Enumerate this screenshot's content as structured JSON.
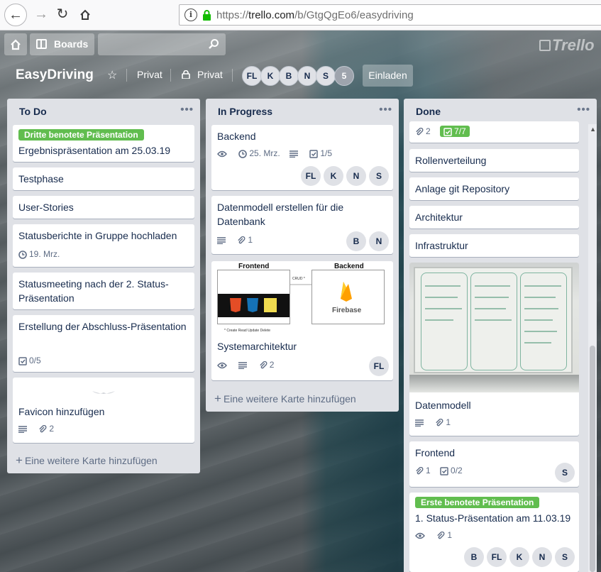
{
  "browser": {
    "url_prefix": "https://",
    "url_host": "trello.com",
    "url_path": "/b/GtgQgEo6/easydriving"
  },
  "header": {
    "boards_label": "Boards",
    "logo_text": "Trello"
  },
  "board": {
    "title": "EasyDriving",
    "visibility_1": "Privat",
    "visibility_2": "Privat",
    "members": [
      "FL",
      "K",
      "B",
      "N",
      "S",
      "5"
    ],
    "invite_label": "Einladen"
  },
  "lists": {
    "todo": {
      "title": "To Do",
      "menu": "•••",
      "add_label": "Eine weitere Karte hinzufügen",
      "cards": {
        "c1": {
          "label": "Dritte benotete Präsentation",
          "title": "Ergebnispräsentation am 25.03.19"
        },
        "c2": {
          "title": "Testphase"
        },
        "c3": {
          "title": "User-Stories"
        },
        "c4": {
          "title": "Statusberichte in Gruppe hochladen",
          "due": "19. Mrz."
        },
        "c5": {
          "title": "Statusmeeting nach der 2. Status-Präsentation"
        },
        "c6": {
          "title": "Erstellung der Abschluss-Präsentation",
          "checklist": "0/5"
        },
        "c7": {
          "title": "Favicon hinzufügen",
          "attachments": "2"
        }
      }
    },
    "progress": {
      "title": "In Progress",
      "menu": "•••",
      "add_label": "Eine weitere Karte hinzufügen",
      "cards": {
        "c1": {
          "title": "Backend",
          "due": "25. Mrz.",
          "checklist": "1/5",
          "members": [
            "FL",
            "K",
            "N",
            "S"
          ]
        },
        "c2": {
          "title": "Datenmodell erstellen für die Datenbank",
          "attachments": "1",
          "members": [
            "B",
            "N"
          ]
        },
        "c3": {
          "title": "Systemarchitektur",
          "attachments": "2",
          "members": [
            "FL"
          ],
          "cover": {
            "frontend": "Frontend",
            "backend": "Backend",
            "crud": "CRUD *",
            "firebase": "Firebase",
            "footnote": "* Create Read Update Delete"
          }
        }
      }
    },
    "done": {
      "title": "Done",
      "menu": "•••",
      "cards": {
        "c0": {
          "attachments": "2",
          "checklist": "7/7"
        },
        "c1": {
          "title": "Rollenverteilung"
        },
        "c2": {
          "title": "Anlage git Repository"
        },
        "c3": {
          "title": "Architektur"
        },
        "c4": {
          "title": "Infrastruktur"
        },
        "c5": {
          "title": "Datenmodell",
          "attachments": "1"
        },
        "c6": {
          "title": "Frontend",
          "attachments": "1",
          "checklist": "0/2",
          "members": [
            "S"
          ]
        },
        "c7": {
          "label": "Erste benotete Präsentation",
          "title": "1. Status-Präsentation am 11.03.19",
          "attachments": "1",
          "members": [
            "B",
            "FL",
            "K",
            "N",
            "S"
          ]
        }
      }
    }
  },
  "colors": {
    "label_green": "#61bd4f",
    "list_bg": "#dfe1e6",
    "card_text": "#172b4d",
    "meta_text": "#5e6c84"
  },
  "icons": [
    "back-arrow-icon",
    "forward-arrow-icon",
    "reload-icon",
    "home-icon",
    "info-icon",
    "lock-icon",
    "boards-icon",
    "search-icon",
    "star-icon",
    "team-icon",
    "watch-icon",
    "clock-icon",
    "description-icon",
    "checklist-icon",
    "attachment-icon"
  ]
}
